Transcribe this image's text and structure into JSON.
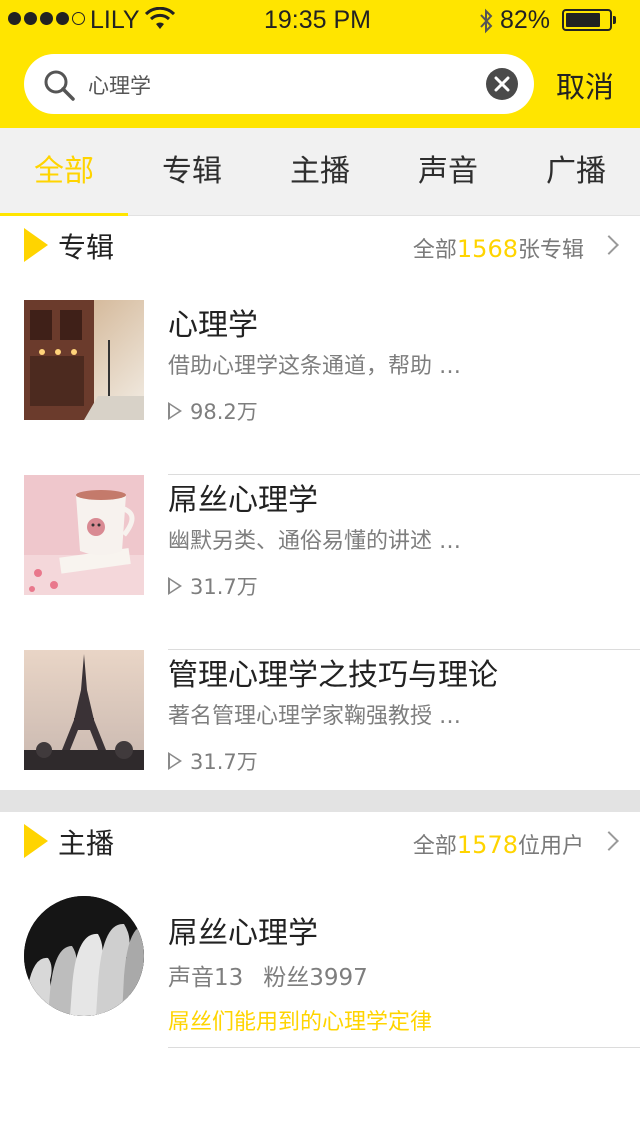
{
  "status_bar": {
    "carrier": "LILY",
    "time": "19:35  PM",
    "battery_percent": "82%",
    "battery_level": 0.82,
    "icons": [
      "signal-dots-icon",
      "wifi-icon",
      "bluetooth-icon",
      "battery-icon"
    ]
  },
  "search": {
    "query": "心理学",
    "cancel_label": "取消",
    "icons": [
      "search-icon",
      "clear-icon"
    ]
  },
  "tabs": [
    {
      "label": "全部",
      "active": true
    },
    {
      "label": "专辑",
      "active": false
    },
    {
      "label": "主播",
      "active": false
    },
    {
      "label": "声音",
      "active": false
    },
    {
      "label": "广播",
      "active": false
    }
  ],
  "albums_section": {
    "title": "专辑",
    "more_prefix": "全部",
    "more_count": "1568",
    "more_suffix": "张专辑",
    "items": [
      {
        "title": "心理学",
        "desc": "借助心理学这条通道，帮助 …",
        "plays": "98.2万",
        "cover": "street-photo"
      },
      {
        "title": "屌丝心理学",
        "desc": "幽默另类、通俗易懂的讲述 …",
        "plays": "31.7万",
        "cover": "cat-mug-photo"
      },
      {
        "title": "管理心理学之技巧与理论",
        "desc": "著名管理心理学家鞠强教授 …",
        "plays": "31.7万",
        "cover": "eiffel-tower-photo"
      }
    ]
  },
  "anchors_section": {
    "title": "主播",
    "more_prefix": "全部",
    "more_count": "1578",
    "more_suffix": "位用户",
    "items": [
      {
        "name": "屌丝心理学",
        "sounds": "声音13",
        "fans": "粉丝3997",
        "desc": "屌丝们能用到的心理学定律",
        "avatar": "profiles-avatar"
      }
    ]
  },
  "colors": {
    "accent_yellow": "#FFE500",
    "highlight_yellow": "#FFD400",
    "tab_bg": "#F1F1F1",
    "divider": "#DCDCDC"
  }
}
